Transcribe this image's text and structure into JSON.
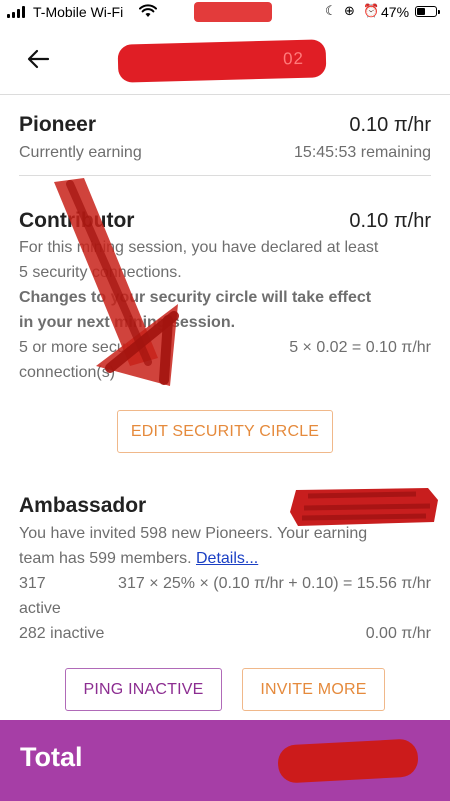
{
  "status_bar": {
    "carrier": "T-Mobile Wi-Fi",
    "battery": "47%",
    "battery_level": 0.47
  },
  "header": {
    "title_fragment": "02"
  },
  "pioneer": {
    "title": "Pioneer",
    "rate": "0.10 π/hr",
    "status": "Currently earning",
    "remaining": "15:45:53 remaining"
  },
  "contributor": {
    "title": "Contributor",
    "rate": "0.10 π/hr",
    "desc_line1": "For this mining session, you have declared at least",
    "desc_line2": "5 security connections.",
    "note_line1": "Changes to your security circle will take effect",
    "note_line2": "in your next mining session.",
    "calc_label_line1": "5 or more security",
    "calc_label_line2": "connection(s)",
    "calc_value": "5 × 0.02 = 0.10 π/hr",
    "edit_button": "EDIT SECURITY CIRCLE"
  },
  "ambassador": {
    "title": "Ambassador",
    "desc_line1": "You have invited 598 new Pioneers. Your earning",
    "desc_line2_prefix": "team has 599 members.",
    "details_link": "Details...",
    "active_count": "317",
    "active_label": "active",
    "active_calc": "317 × 25% × (0.10 π/hr + 0.10) = 15.56 π/hr",
    "inactive_label": "282 inactive",
    "inactive_value": "0.00 π/hr",
    "ping_button": "PING INACTIVE",
    "invite_button": "INVITE MORE"
  },
  "total": {
    "label": "Total"
  },
  "colors": {
    "accent_orange": "#e58a3c",
    "accent_purple": "#8c2d91",
    "total_bar": "#a63ea6",
    "redaction_red": "#e01e25"
  }
}
